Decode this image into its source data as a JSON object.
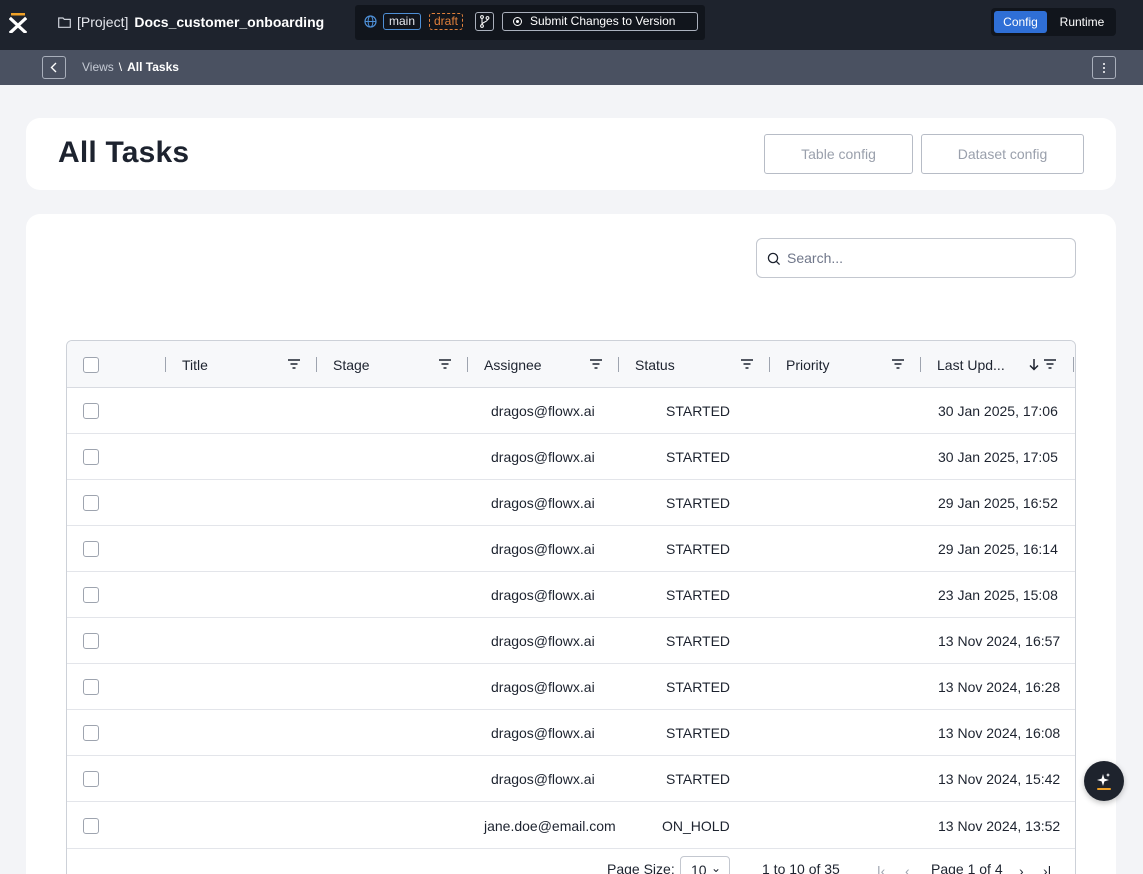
{
  "topbar": {
    "project_prefix": "[Project]",
    "project_name": "Docs_customer_onboarding",
    "branch": "main",
    "state": "draft",
    "submit_label": "Submit Changes to Version",
    "mode_config": "Config",
    "mode_runtime": "Runtime",
    "accent": "#2f6fd6"
  },
  "breadcrumb": {
    "parent": "Views",
    "separator": "\\",
    "current": "All Tasks"
  },
  "header": {
    "title": "All Tasks",
    "table_config_label": "Table config",
    "dataset_config_label": "Dataset config"
  },
  "search": {
    "placeholder": "Search..."
  },
  "table": {
    "columns": [
      "Title",
      "Stage",
      "Assignee",
      "Status",
      "Priority",
      "Last Upd..."
    ],
    "sorted_column": "Last Upd...",
    "sort_direction": "descending",
    "rows": [
      {
        "title": "",
        "stage": "",
        "assignee": "dragos@flowx.ai",
        "status": "STARTED",
        "priority": "",
        "updated": "30 Jan 2025, 17:06"
      },
      {
        "title": "",
        "stage": "",
        "assignee": "dragos@flowx.ai",
        "status": "STARTED",
        "priority": "",
        "updated": "30 Jan 2025, 17:05"
      },
      {
        "title": "",
        "stage": "",
        "assignee": "dragos@flowx.ai",
        "status": "STARTED",
        "priority": "",
        "updated": "29 Jan 2025, 16:52"
      },
      {
        "title": "",
        "stage": "",
        "assignee": "dragos@flowx.ai",
        "status": "STARTED",
        "priority": "",
        "updated": "29 Jan 2025, 16:14"
      },
      {
        "title": "",
        "stage": "",
        "assignee": "dragos@flowx.ai",
        "status": "STARTED",
        "priority": "",
        "updated": "23 Jan 2025, 15:08"
      },
      {
        "title": "",
        "stage": "",
        "assignee": "dragos@flowx.ai",
        "status": "STARTED",
        "priority": "",
        "updated": "13 Nov 2024, 16:57"
      },
      {
        "title": "",
        "stage": "",
        "assignee": "dragos@flowx.ai",
        "status": "STARTED",
        "priority": "",
        "updated": "13 Nov 2024, 16:28"
      },
      {
        "title": "",
        "stage": "",
        "assignee": "dragos@flowx.ai",
        "status": "STARTED",
        "priority": "",
        "updated": "13 Nov 2024, 16:08"
      },
      {
        "title": "",
        "stage": "",
        "assignee": "dragos@flowx.ai",
        "status": "STARTED",
        "priority": "",
        "updated": "13 Nov 2024, 15:42"
      },
      {
        "title": "",
        "stage": "",
        "assignee": "jane.doe@email.com",
        "status": "ON_HOLD",
        "priority": "",
        "updated": "13 Nov 2024, 13:52"
      }
    ]
  },
  "pager": {
    "page_size_label": "Page Size:",
    "page_size": "10",
    "range": "1 to 10 of 35",
    "page": "Page 1 of 4"
  }
}
